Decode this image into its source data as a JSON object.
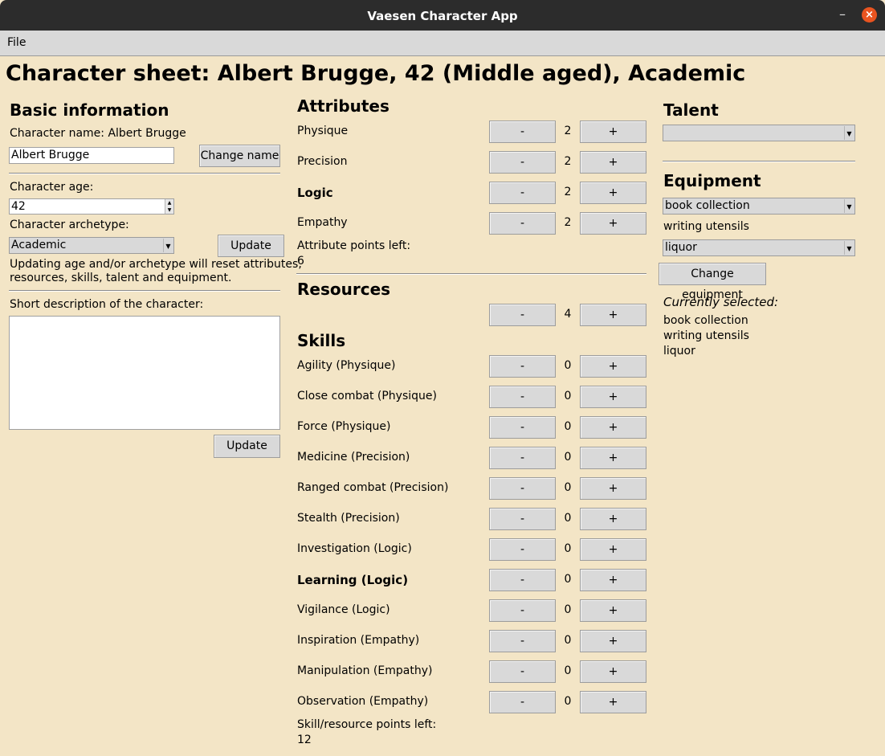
{
  "window": {
    "title": "Vaesen Character App"
  },
  "menu": {
    "file": "File"
  },
  "header": {
    "title": "Character sheet: Albert Brugge, 42 (Middle aged), Academic"
  },
  "basic": {
    "heading": "Basic information",
    "name_label": "Character name: Albert Brugge",
    "name_value": "Albert Brugge",
    "change_name": "Change name",
    "age_label": "Character age:",
    "age_value": "42",
    "archetype_label": "Character archetype:",
    "archetype_value": "Academic",
    "update": "Update",
    "warning_line1": "Updating age and/or archetype will reset attributes,",
    "warning_line2": "resources, skills, talent and equipment.",
    "desc_label": "Short description of the character:",
    "desc_value": "",
    "desc_update": "Update"
  },
  "attributes": {
    "heading": "Attributes",
    "items": [
      {
        "name": "Physique",
        "value": "2",
        "bold": false
      },
      {
        "name": "Precision",
        "value": "2",
        "bold": false
      },
      {
        "name": "Logic",
        "value": "2",
        "bold": true
      },
      {
        "name": "Empathy",
        "value": "2",
        "bold": false
      }
    ],
    "points_label": "Attribute points left:",
    "points_value": "6"
  },
  "resources": {
    "heading": "Resources",
    "value": "4"
  },
  "skills": {
    "heading": "Skills",
    "items": [
      {
        "name": "Agility (Physique)",
        "value": "0",
        "bold": false
      },
      {
        "name": "Close combat (Physique)",
        "value": "0",
        "bold": false
      },
      {
        "name": "Force (Physique)",
        "value": "0",
        "bold": false
      },
      {
        "name": "Medicine (Precision)",
        "value": "0",
        "bold": false
      },
      {
        "name": "Ranged combat (Precision)",
        "value": "0",
        "bold": false
      },
      {
        "name": "Stealth (Precision)",
        "value": "0",
        "bold": false
      },
      {
        "name": "Investigation (Logic)",
        "value": "0",
        "bold": false
      },
      {
        "name": "Learning (Logic)",
        "value": "0",
        "bold": true
      },
      {
        "name": "Vigilance (Logic)",
        "value": "0",
        "bold": false
      },
      {
        "name": "Inspiration (Empathy)",
        "value": "0",
        "bold": false
      },
      {
        "name": "Manipulation (Empathy)",
        "value": "0",
        "bold": false
      },
      {
        "name": "Observation (Empathy)",
        "value": "0",
        "bold": false
      }
    ],
    "points_label": "Skill/resource points left:",
    "points_value": "12"
  },
  "buttons": {
    "minus": "-",
    "plus": "+"
  },
  "talent": {
    "heading": "Talent",
    "value": ""
  },
  "equipment": {
    "heading": "Equipment",
    "select1": "book collection",
    "fixed": "writing utensils",
    "select2": "liquor",
    "change": "Change equipment",
    "selected_label": "Currently selected:",
    "selected_items": [
      "book collection",
      "writing utensils",
      "liquor"
    ]
  },
  "colors": {
    "background": "#f3e5c6",
    "titlebar": "#2c2c2c",
    "close": "#e95420",
    "button": "#d9d9d9"
  }
}
